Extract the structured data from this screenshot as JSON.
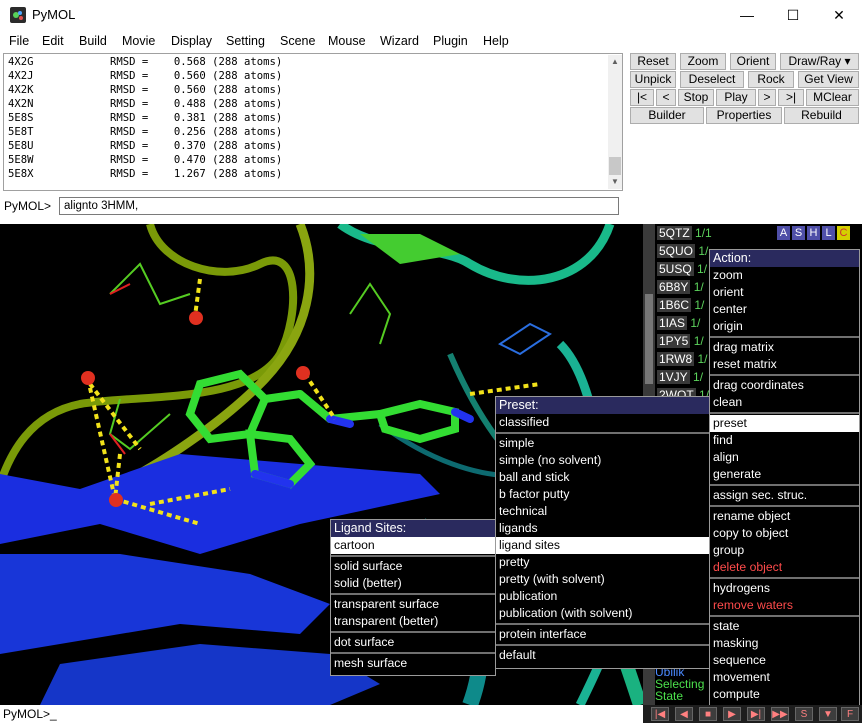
{
  "window": {
    "title": "PyMOL",
    "controls": {
      "minimize": "—",
      "maximize": "☐",
      "close": "✕"
    }
  },
  "menubar": [
    "File",
    "Edit",
    "Build",
    "Movie",
    "Display",
    "Setting",
    "Scene",
    "Mouse",
    "Wizard",
    "Plugin",
    "Help"
  ],
  "output_lines": [
    "4X2G            RMSD =    0.568 (288 atoms)",
    "4X2J            RMSD =    0.560 (288 atoms)",
    "4X2K            RMSD =    0.560 (288 atoms)",
    "4X2N            RMSD =    0.488 (288 atoms)",
    "5E8S            RMSD =    0.381 (288 atoms)",
    "5E8T            RMSD =    0.256 (288 atoms)",
    "5E8U            RMSD =    0.370 (288 atoms)",
    "5E8W            RMSD =    0.470 (288 atoms)",
    "5E8X            RMSD =    1.267 (288 atoms)"
  ],
  "command": {
    "prompt": "PyMOL>",
    "value": "alignto 3HMM,"
  },
  "buttons": {
    "reset": "Reset",
    "zoom": "Zoom",
    "orient": "Orient",
    "draw_ray": "Draw/Ray ▾",
    "unpick": "Unpick",
    "deselect": "Deselect",
    "rock": "Rock",
    "get_view": "Get View",
    "rewind": "|<",
    "back": "<",
    "stop": "Stop",
    "play": "Play",
    "forward": ">",
    "end": ">|",
    "mclear": "MClear",
    "builder": "Builder",
    "properties": "Properties",
    "rebuild": "Rebuild"
  },
  "objects": [
    {
      "name": "5QTZ",
      "count": "1/1"
    },
    {
      "name": "5QUO",
      "count": "1/"
    },
    {
      "name": "5USQ",
      "count": "1/"
    },
    {
      "name": "6B8Y",
      "count": "1/"
    },
    {
      "name": "1B6C",
      "count": "1/"
    },
    {
      "name": "1IAS",
      "count": "1/"
    },
    {
      "name": "1PY5",
      "count": "1/"
    },
    {
      "name": "1RW8",
      "count": "1/"
    },
    {
      "name": "1VJY",
      "count": "1/"
    },
    {
      "name": "2WOT",
      "count": "1/"
    }
  ],
  "object_buttons": [
    "A",
    "S",
    "H",
    "L",
    "C"
  ],
  "action_menu": {
    "header": "Action:",
    "groups": [
      [
        "zoom",
        "orient",
        "center",
        "origin"
      ],
      [
        "drag matrix",
        "reset matrix"
      ],
      [
        "drag coordinates",
        "clean"
      ],
      [
        "preset",
        "find",
        "align",
        "generate"
      ],
      [
        "assign sec. struc."
      ],
      [
        "rename object",
        "copy to object",
        "group",
        "delete object"
      ],
      [
        "hydrogens",
        "remove waters"
      ],
      [
        "state",
        "masking",
        "sequence",
        "movement",
        "compute"
      ]
    ],
    "highlighted": "preset",
    "red_items": [
      "delete object",
      "remove waters"
    ]
  },
  "preset_menu": {
    "header": "Preset:",
    "groups": [
      [
        "classified"
      ],
      [
        "simple",
        "simple (no solvent)",
        "ball and stick",
        "b factor putty",
        "technical",
        "ligands",
        "ligand sites",
        "pretty",
        "pretty (with solvent)",
        "publication",
        "publication (with solvent)"
      ],
      [
        "protein interface"
      ],
      [
        "default"
      ]
    ],
    "highlighted": "ligand sites"
  },
  "ligand_menu": {
    "header": "Ligand Sites:",
    "groups": [
      [
        "cartoon"
      ],
      [
        "solid surface",
        "solid (better)"
      ],
      [
        "transparent surface",
        "transparent (better)"
      ],
      [
        "dot surface"
      ],
      [
        "mesh surface"
      ]
    ],
    "highlighted": "cartoon"
  },
  "status": {
    "line1": "Ubilik",
    "line2": "Selecting",
    "line3": "State"
  },
  "bottom_prompt": "PyMOL>_",
  "movie_controls": [
    "|◀",
    "◀",
    "■",
    "▶",
    "▶|",
    "▶▶",
    "S",
    "▼",
    "F"
  ],
  "colors": {
    "accent_header": "#2a2a5e",
    "red_item": "#ff4b4b",
    "count_green": "#5cd35c"
  }
}
